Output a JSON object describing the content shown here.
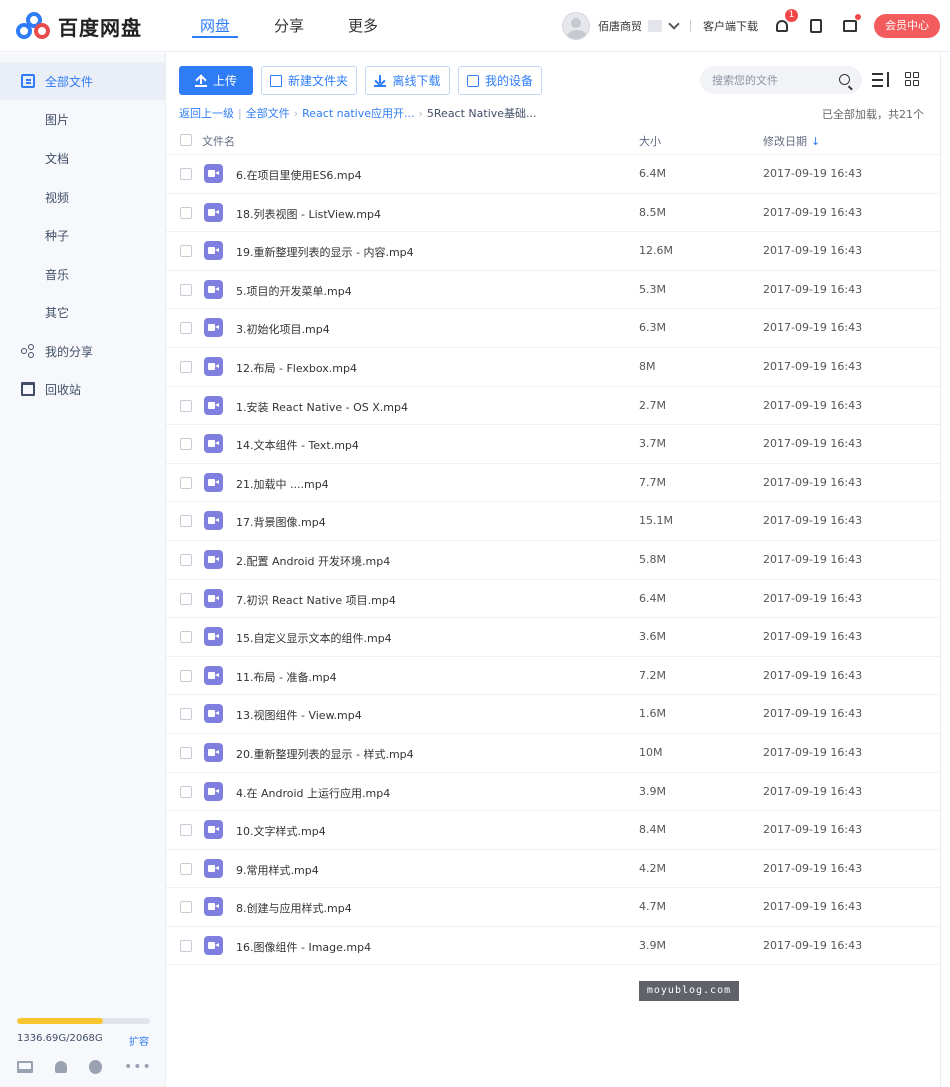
{
  "brand": {
    "name": "百度网盘"
  },
  "nav": [
    {
      "label": "网盘",
      "active": true
    },
    {
      "label": "分享",
      "active": false
    },
    {
      "label": "更多",
      "active": false
    }
  ],
  "header": {
    "username": "佰唐商贸",
    "client_download": "客户端下载",
    "notification_count": "1",
    "vip_center": "会员中心"
  },
  "sidebar": {
    "items": [
      {
        "label": "全部文件",
        "icon": "files-icon",
        "active": true
      },
      {
        "label": "图片"
      },
      {
        "label": "文档"
      },
      {
        "label": "视频"
      },
      {
        "label": "种子"
      },
      {
        "label": "音乐"
      },
      {
        "label": "其它"
      },
      {
        "label": "我的分享",
        "icon": "share-icon"
      },
      {
        "label": "回收站",
        "icon": "trash-icon"
      }
    ],
    "quota": {
      "used_text": "1336.69G/2068G",
      "used_fraction": 0.646,
      "expand": "扩容"
    }
  },
  "toolbar": {
    "upload": "上传",
    "new_folder": "新建文件夹",
    "offline_download": "离线下载",
    "my_devices": "我的设备"
  },
  "search": {
    "placeholder": "搜索您的文件"
  },
  "breadcrumb": {
    "back": "返回上一级",
    "root": "全部文件",
    "parent": "React native应用开...",
    "current": "5React Native基础..."
  },
  "load_status": "已全部加载，共21个",
  "table": {
    "headers": {
      "name": "文件名",
      "size": "大小",
      "modified": "修改日期"
    },
    "rows": [
      {
        "name": "6.在项目里使用ES6.mp4",
        "size": "6.4M",
        "modified": "2017-09-19 16:43"
      },
      {
        "name": "18.列表视图 - ListView.mp4",
        "size": "8.5M",
        "modified": "2017-09-19 16:43"
      },
      {
        "name": "19.重新整理列表的显示 - 内容.mp4",
        "size": "12.6M",
        "modified": "2017-09-19 16:43"
      },
      {
        "name": "5.项目的开发菜单.mp4",
        "size": "5.3M",
        "modified": "2017-09-19 16:43"
      },
      {
        "name": "3.初始化项目.mp4",
        "size": "6.3M",
        "modified": "2017-09-19 16:43"
      },
      {
        "name": "12.布局 - Flexbox.mp4",
        "size": "8M",
        "modified": "2017-09-19 16:43"
      },
      {
        "name": "1.安装 React Native - OS X.mp4",
        "size": "2.7M",
        "modified": "2017-09-19 16:43"
      },
      {
        "name": "14.文本组件 - Text.mp4",
        "size": "3.7M",
        "modified": "2017-09-19 16:43"
      },
      {
        "name": "21.加载中 ....mp4",
        "size": "7.7M",
        "modified": "2017-09-19 16:43"
      },
      {
        "name": "17.背景图像.mp4",
        "size": "15.1M",
        "modified": "2017-09-19 16:43"
      },
      {
        "name": "2.配置 Android 开发环境.mp4",
        "size": "5.8M",
        "modified": "2017-09-19 16:43"
      },
      {
        "name": "7.初识 React Native 项目.mp4",
        "size": "6.4M",
        "modified": "2017-09-19 16:43"
      },
      {
        "name": "15.自定义显示文本的组件.mp4",
        "size": "3.6M",
        "modified": "2017-09-19 16:43"
      },
      {
        "name": "11.布局 - 准备.mp4",
        "size": "7.2M",
        "modified": "2017-09-19 16:43"
      },
      {
        "name": "13.视图组件 - View.mp4",
        "size": "1.6M",
        "modified": "2017-09-19 16:43"
      },
      {
        "name": "20.重新整理列表的显示 - 样式.mp4",
        "size": "10M",
        "modified": "2017-09-19 16:43"
      },
      {
        "name": "4.在 Android 上运行应用.mp4",
        "size": "3.9M",
        "modified": "2017-09-19 16:43"
      },
      {
        "name": "10.文字样式.mp4",
        "size": "8.4M",
        "modified": "2017-09-19 16:43"
      },
      {
        "name": "9.常用样式.mp4",
        "size": "4.2M",
        "modified": "2017-09-19 16:43"
      },
      {
        "name": "8.创建与应用样式.mp4",
        "size": "4.7M",
        "modified": "2017-09-19 16:43"
      },
      {
        "name": "16.图像组件 - Image.mp4",
        "size": "3.9M",
        "modified": "2017-09-19 16:43"
      }
    ]
  },
  "watermark": "moyublog.com",
  "colors": {
    "accent": "#2f7df6",
    "video_icon": "#7f7fe0",
    "vip": "#f25c5c",
    "quota_fill": "#f7c52f"
  }
}
